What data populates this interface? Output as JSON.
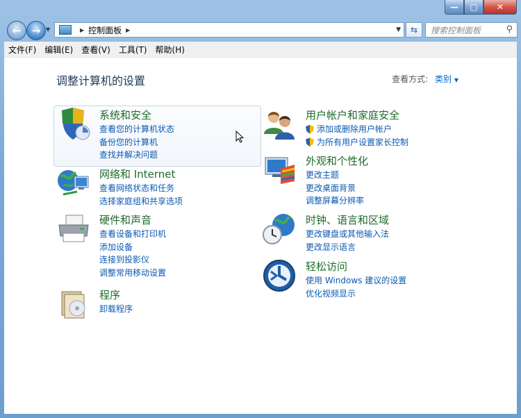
{
  "titlebar": {
    "min": "—",
    "max": "▢",
    "close": "✕"
  },
  "nav": {
    "back": "←",
    "forward": "→"
  },
  "address": {
    "path": "控制面板"
  },
  "search": {
    "placeholder": "搜索控制面板"
  },
  "menu": [
    "文件(F)",
    "编辑(E)",
    "查看(V)",
    "工具(T)",
    "帮助(H)"
  ],
  "page": {
    "heading": "调整计算机的设置",
    "view_by_label": "查看方式:",
    "view_by_value": "类别"
  },
  "categories": [
    {
      "title": "系统和安全",
      "icon": "system-security-icon",
      "links": [
        "查看您的计算机状态",
        "备份您的计算机",
        "查找并解决问题"
      ]
    },
    {
      "title": "网络和 Internet",
      "icon": "network-icon",
      "links": [
        "查看网络状态和任务",
        "选择家庭组和共享选项"
      ]
    },
    {
      "title": "硬件和声音",
      "icon": "printer-icon",
      "links": [
        "查看设备和打印机",
        "添加设备",
        "连接到投影仪",
        "调整常用移动设置"
      ]
    },
    {
      "title": "程序",
      "icon": "programs-icon",
      "links": [
        "卸载程序"
      ]
    },
    {
      "title": "用户帐户和家庭安全",
      "icon": "users-icon",
      "links": [
        "添加或删除用户帐户",
        "为所有用户设置家长控制"
      ]
    },
    {
      "title": "外观和个性化",
      "icon": "appearance-icon",
      "links": [
        "更改主题",
        "更改桌面背景",
        "调整屏幕分辨率"
      ]
    },
    {
      "title": "时钟、语言和区域",
      "icon": "clock-globe-icon",
      "links": [
        "更改键盘或其他输入法",
        "更改显示语言"
      ]
    },
    {
      "title": "轻松访问",
      "icon": "ease-of-access-icon",
      "links": [
        "使用 Windows 建议的设置",
        "优化视频显示"
      ]
    }
  ]
}
